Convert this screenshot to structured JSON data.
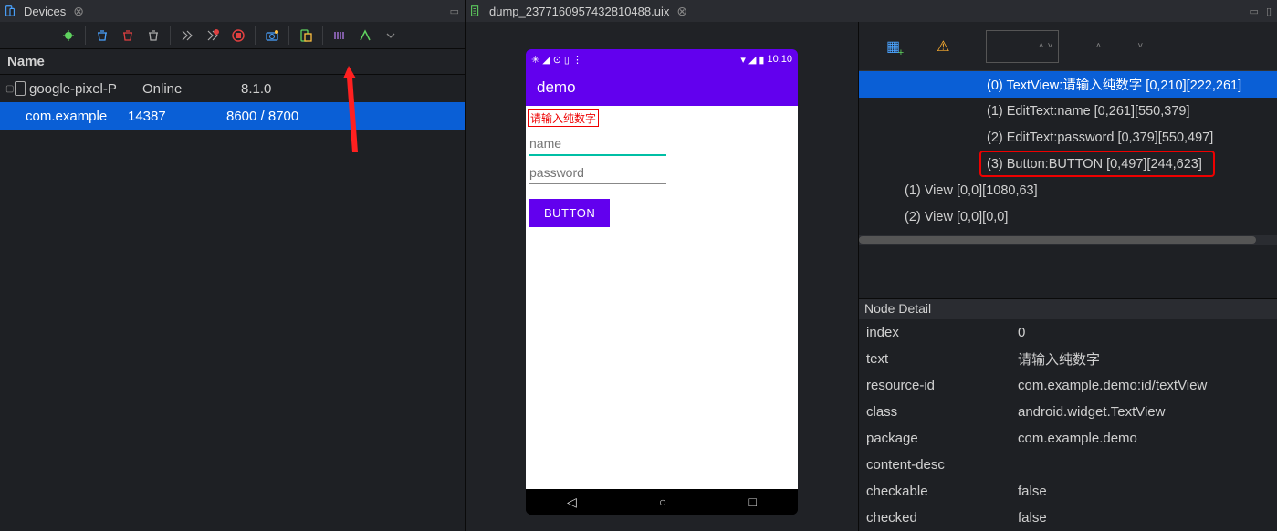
{
  "devices_panel": {
    "title": "Devices",
    "header": "Name",
    "rows": [
      {
        "name": "google-pixel-P",
        "status": "Online",
        "version": "8.1.0",
        "selected": false
      },
      {
        "name": "com.example",
        "status": "14387",
        "version": "8600 / 8700",
        "selected": true
      }
    ]
  },
  "dump_panel": {
    "title": "dump_2377160957432810488.uix"
  },
  "phone": {
    "time": "10:10",
    "app_title": "demo",
    "hint_text": "请输入纯数字",
    "name_placeholder": "name",
    "password_placeholder": "password",
    "button_label": "BUTTON"
  },
  "tree": {
    "rows": [
      {
        "label": "(0) TextView:请输入纯数字 [0,210][222,261]",
        "indent": "ind1",
        "selected": true
      },
      {
        "label": "(1) EditText:name [0,261][550,379]",
        "indent": "ind1",
        "selected": false
      },
      {
        "label": "(2) EditText:password [0,379][550,497]",
        "indent": "ind1",
        "selected": false
      },
      {
        "label": "(3) Button:BUTTON [0,497][244,623]",
        "indent": "ind1",
        "selected": false
      },
      {
        "label": "(1) View [0,0][1080,63]",
        "indent": "ind0",
        "selected": false
      },
      {
        "label": "(2) View [0,0][0,0]",
        "indent": "ind0",
        "selected": false
      }
    ]
  },
  "node_detail": {
    "title": "Node Detail",
    "rows": [
      {
        "key": "index",
        "val": "0"
      },
      {
        "key": "text",
        "val": "请输入纯数字"
      },
      {
        "key": "resource-id",
        "val": "com.example.demo:id/textView"
      },
      {
        "key": "class",
        "val": "android.widget.TextView"
      },
      {
        "key": "package",
        "val": "com.example.demo"
      },
      {
        "key": "content-desc",
        "val": ""
      },
      {
        "key": "checkable",
        "val": "false"
      },
      {
        "key": "checked",
        "val": "false"
      }
    ]
  }
}
